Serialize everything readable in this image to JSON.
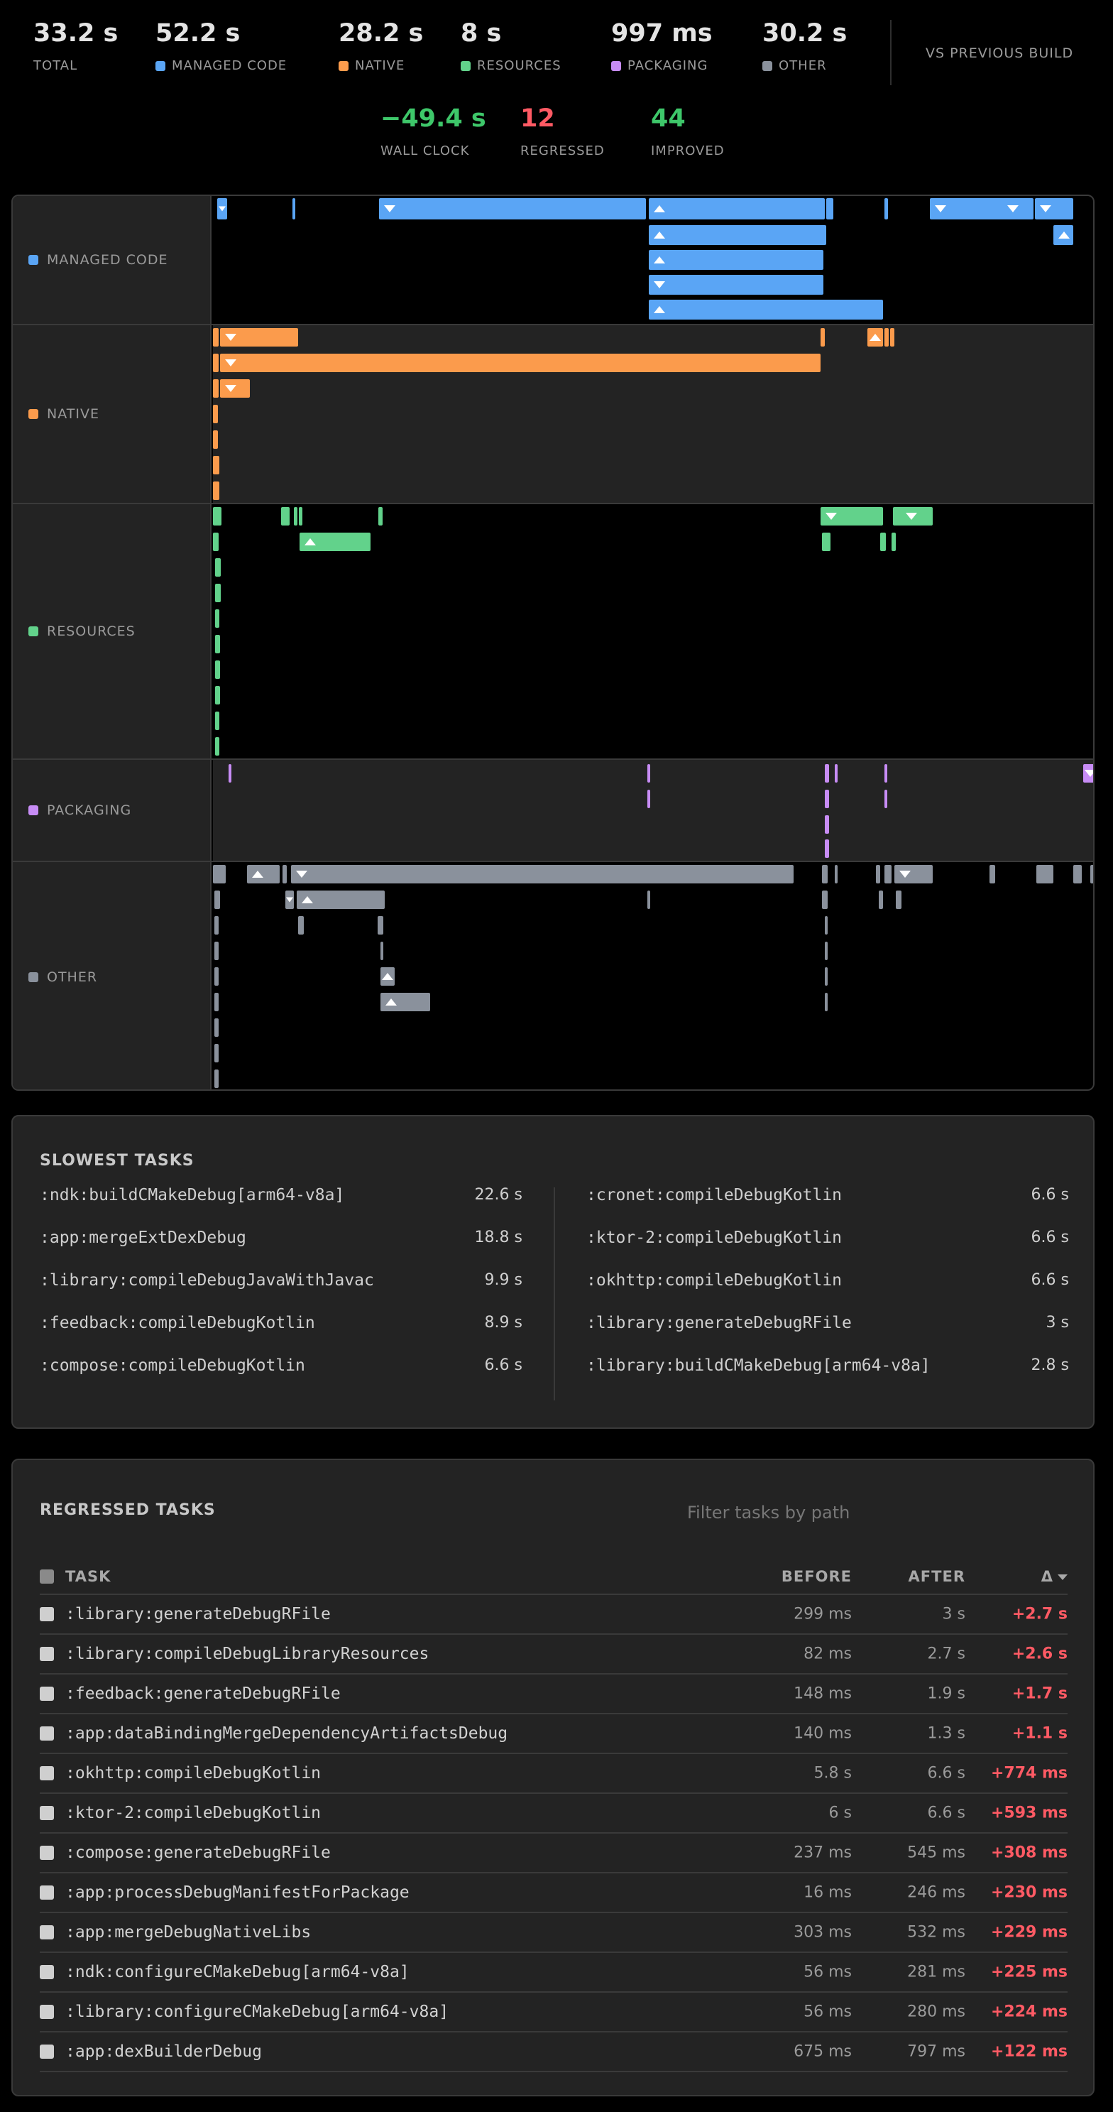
{
  "summary": {
    "total": {
      "value": "33.2 s",
      "label": "TOTAL"
    },
    "managed": {
      "value": "52.2 s",
      "label": "MANAGED CODE",
      "color": "#5aa5f5"
    },
    "native": {
      "value": "28.2 s",
      "label": "NATIVE",
      "color": "#fb9b4c"
    },
    "resources": {
      "value": "8 s",
      "label": "RESOURCES",
      "color": "#62d28b"
    },
    "packaging": {
      "value": "997 ms",
      "label": "PACKAGING",
      "color": "#c78cf5"
    },
    "other": {
      "value": "30.2 s",
      "label": "OTHER",
      "color": "#8a919c"
    },
    "vs_label": "VS PREVIOUS BUILD",
    "wall_clock": {
      "value": "−49.4 s",
      "label": "WALL CLOCK",
      "color": "#3ec76a"
    },
    "regressed": {
      "value": "12",
      "label": "REGRESSED",
      "color": "#ff5a64"
    },
    "improved": {
      "value": "44",
      "label": "IMPROVED",
      "color": "#3ec76a"
    }
  },
  "lanes": {
    "managed": "MANAGED CODE",
    "native": "NATIVE",
    "resources": "RESOURCES",
    "packaging": "PACKAGING",
    "other": "OTHER"
  },
  "slowest": {
    "title": "SLOWEST TASKS",
    "left": [
      {
        "task": ":ndk:buildCMakeDebug[arm64-v8a]",
        "duration": "22.6 s"
      },
      {
        "task": ":app:mergeExtDexDebug",
        "duration": "18.8 s"
      },
      {
        "task": ":library:compileDebugJavaWithJavac",
        "duration": "9.9 s"
      },
      {
        "task": ":feedback:compileDebugKotlin",
        "duration": "8.9 s"
      },
      {
        "task": ":compose:compileDebugKotlin",
        "duration": "6.6 s"
      }
    ],
    "right": [
      {
        "task": ":cronet:compileDebugKotlin",
        "duration": "6.6 s"
      },
      {
        "task": ":ktor-2:compileDebugKotlin",
        "duration": "6.6 s"
      },
      {
        "task": ":okhttp:compileDebugKotlin",
        "duration": "6.6 s"
      },
      {
        "task": ":library:generateDebugRFile",
        "duration": "3 s"
      },
      {
        "task": ":library:buildCMakeDebug[arm64-v8a]",
        "duration": "2.8 s"
      }
    ]
  },
  "regressed": {
    "title": "REGRESSED TASKS",
    "filter_placeholder": "Filter tasks by path",
    "headers": {
      "task": "TASK",
      "before": "BEFORE",
      "after": "AFTER",
      "delta": "Δ"
    },
    "rows": [
      {
        "task": ":library:generateDebugRFile",
        "before": "299 ms",
        "after": "3 s",
        "delta": "+2.7 s"
      },
      {
        "task": ":library:compileDebugLibraryResources",
        "before": "82 ms",
        "after": "2.7 s",
        "delta": "+2.6 s"
      },
      {
        "task": ":feedback:generateDebugRFile",
        "before": "148 ms",
        "after": "1.9 s",
        "delta": "+1.7 s"
      },
      {
        "task": ":app:dataBindingMergeDependencyArtifactsDebug",
        "before": "140 ms",
        "after": "1.3 s",
        "delta": "+1.1 s"
      },
      {
        "task": ":okhttp:compileDebugKotlin",
        "before": "5.8 s",
        "after": "6.6 s",
        "delta": "+774 ms"
      },
      {
        "task": ":ktor-2:compileDebugKotlin",
        "before": "6 s",
        "after": "6.6 s",
        "delta": "+593 ms"
      },
      {
        "task": ":compose:generateDebugRFile",
        "before": "237 ms",
        "after": "545 ms",
        "delta": "+308 ms"
      },
      {
        "task": ":app:processDebugManifestForPackage",
        "before": "16 ms",
        "after": "246 ms",
        "delta": "+230 ms"
      },
      {
        "task": ":app:mergeDebugNativeLibs",
        "before": "303 ms",
        "after": "532 ms",
        "delta": "+229 ms"
      },
      {
        "task": ":ndk:configureCMakeDebug[arm64-v8a]",
        "before": "56 ms",
        "after": "281 ms",
        "delta": "+225 ms"
      },
      {
        "task": ":library:configureCMakeDebug[arm64-v8a]",
        "before": "56 ms",
        "after": "280 ms",
        "delta": "+224 ms"
      },
      {
        "task": ":app:dexBuilderDebug",
        "before": "675 ms",
        "after": "797 ms",
        "delta": "+122 ms"
      }
    ]
  }
}
